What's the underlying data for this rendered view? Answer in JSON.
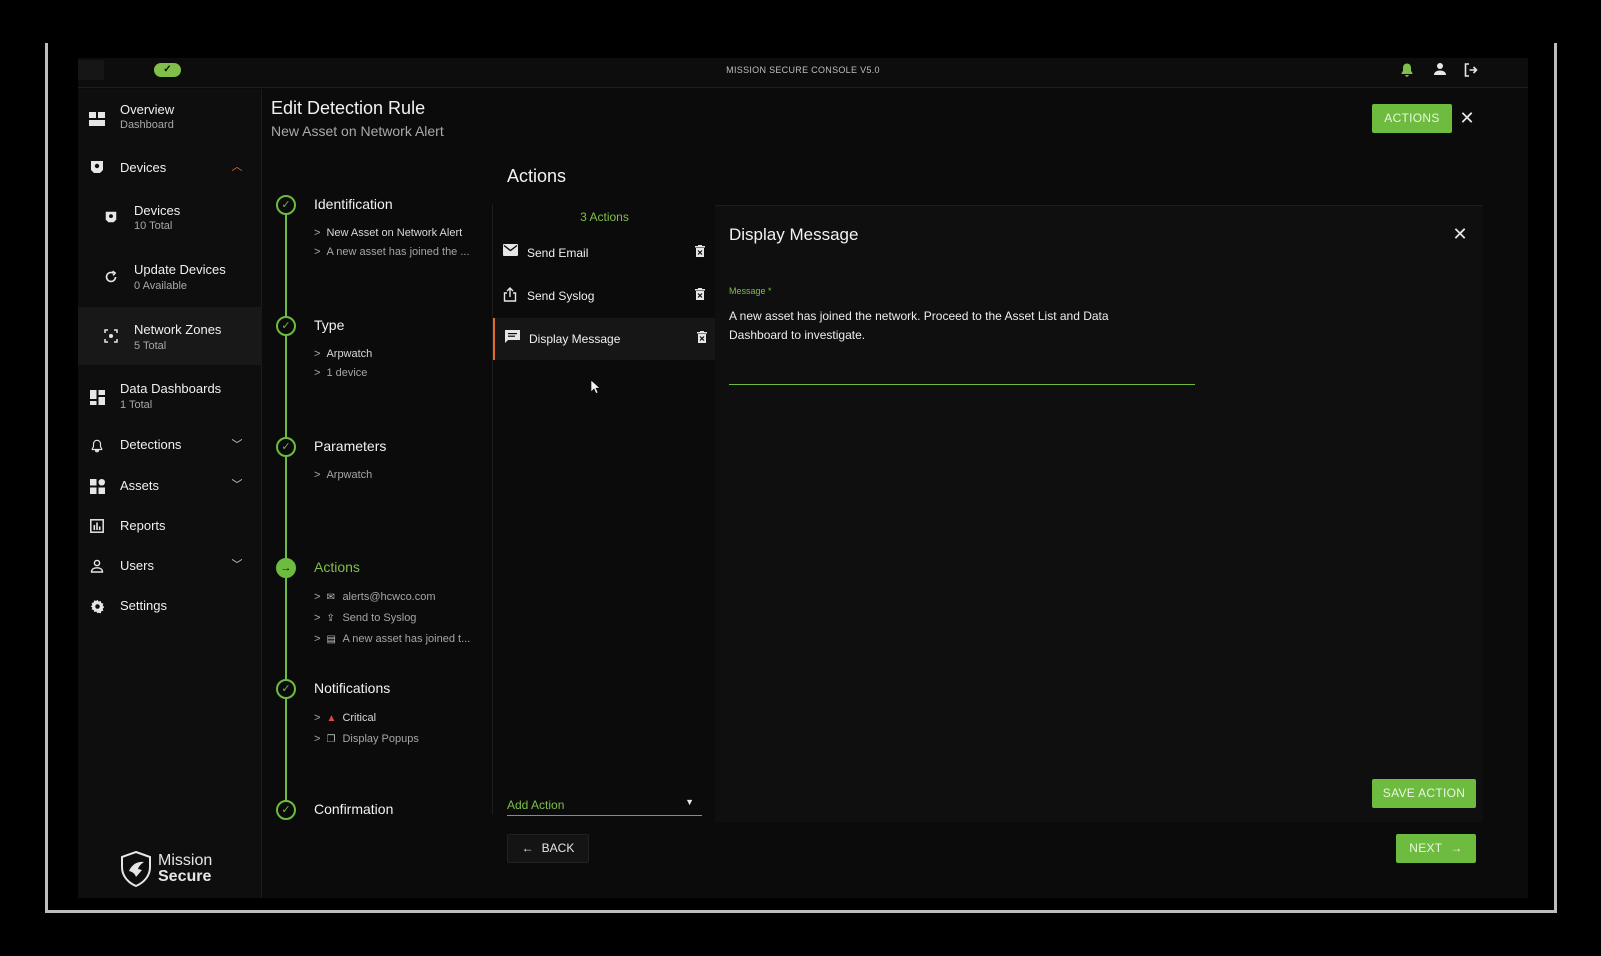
{
  "topbar": {
    "title": "MISSION SECURE CONSOLE V5.0",
    "status_pill_icon": "check-icon",
    "accent": "#6dbb3f"
  },
  "sidebar": {
    "items": [
      {
        "label": "Overview",
        "sub": "Dashboard",
        "icon": "dashboard-icon"
      },
      {
        "label": "Devices",
        "icon": "device-icon"
      },
      {
        "label": "Devices",
        "sub": "10 Total",
        "icon": "device-icon"
      },
      {
        "label": "Update Devices",
        "sub": "0 Available",
        "icon": "refresh-icon"
      },
      {
        "label": "Network Zones",
        "sub": "5 Total",
        "icon": "zone-icon"
      },
      {
        "label": "Data Dashboards",
        "sub": "1 Total",
        "icon": "grid-icon"
      },
      {
        "label": "Detections",
        "icon": "bell-icon"
      },
      {
        "label": "Assets",
        "icon": "assets-icon"
      },
      {
        "label": "Reports",
        "icon": "reports-icon"
      },
      {
        "label": "Users",
        "icon": "user-icon"
      },
      {
        "label": "Settings",
        "icon": "gear-icon"
      }
    ],
    "brand_line1": "Mission",
    "brand_line2": "Secure"
  },
  "header": {
    "title": "Edit Detection Rule",
    "subtitle": "New Asset on Network Alert",
    "actions_button": "ACTIONS"
  },
  "steps": [
    {
      "name": "Identification",
      "lines": [
        "New Asset on Network Alert",
        "A new asset has joined the ..."
      ]
    },
    {
      "name": "Type",
      "lines": [
        "Arpwatch",
        "1 device"
      ]
    },
    {
      "name": "Parameters",
      "lines": [
        "Arpwatch"
      ]
    },
    {
      "name": "Actions",
      "lines": [
        "alerts@hcwco.com",
        "Send to Syslog",
        "A new asset has joined t..."
      ]
    },
    {
      "name": "Notifications",
      "lines": [
        "Critical",
        "Display Popups"
      ]
    },
    {
      "name": "Confirmation",
      "lines": []
    }
  ],
  "actions": {
    "title": "Actions",
    "count_label": "3 Actions",
    "items": [
      {
        "label": "Send Email",
        "icon": "mail-icon"
      },
      {
        "label": "Send Syslog",
        "icon": "share-icon"
      },
      {
        "label": "Display Message",
        "icon": "message-icon"
      }
    ],
    "add_action_label": "Add Action"
  },
  "panel": {
    "title": "Display Message",
    "field_label": "Message *",
    "field_value": "A new asset has joined the network. Proceed to the Asset List and Data Dashboard to investigate.",
    "save_button": "SAVE ACTION"
  },
  "footer": {
    "back_button": "BACK",
    "next_button": "NEXT"
  }
}
